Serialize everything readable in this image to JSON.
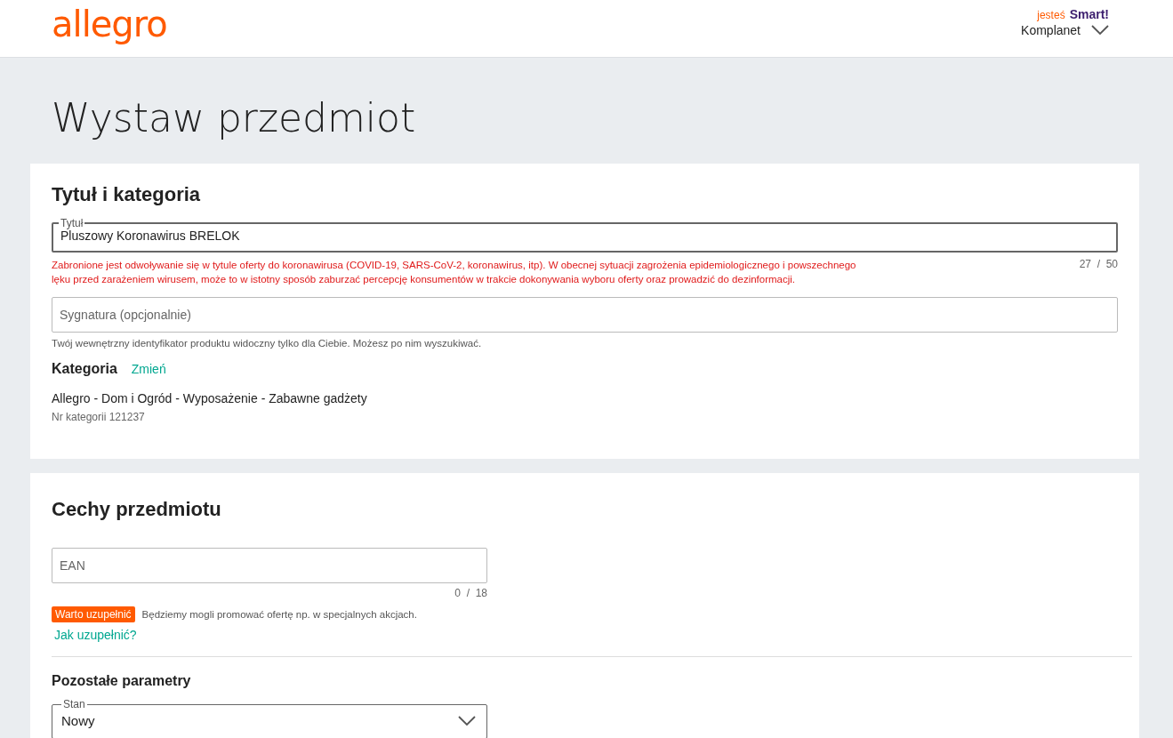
{
  "header": {
    "logo": "allegro",
    "smart_prefix": "jesteś",
    "smart_label": "Smart!",
    "user": "Komplanet"
  },
  "page_title": "Wystaw przedmiot",
  "title_section": {
    "heading": "Tytuł i kategoria",
    "title_field": {
      "label": "Tytuł",
      "value": "Pluszowy Koronawirus BRELOK",
      "error": "Zabronione jest odwoływanie się w tytule oferty do koronawirusa (COVID-19, SARS-CoV-2, koronawirus, itp). W obecnej sytuacji zagrożenia epidemiologicznego i powszechnego lęku przed zarażeniem wirusem, może to w istotny sposób zaburzać percepcję konsumentów w trakcie dokonywania wyboru oferty oraz prowadzić do dezinformacji.",
      "counter": "27  /  50"
    },
    "signature_field": {
      "placeholder": "Sygnatura (opcjonalnie)",
      "hint": "Twój wewnętrzny identyfikator produktu widoczny tylko dla Ciebie. Możesz po nim wyszukiwać."
    },
    "category": {
      "label": "Kategoria",
      "change_link": "Zmień",
      "path": "Allegro - Dom i Ogród - Wyposażenie - Zabawne gadżety",
      "number": "Nr kategorii 121237"
    }
  },
  "features_section": {
    "heading": "Cechy przedmiotu",
    "ean_field": {
      "placeholder": "EAN",
      "counter": "0  /  18",
      "badge": "Warto uzupełnić",
      "hint": "Będziemy mogli promować ofertę np. w specjalnych akcjach.",
      "help_link": "Jak uzupełnić?"
    },
    "other_heading": "Pozostałe parametry",
    "condition_field": {
      "label": "Stan",
      "value": "Nowy"
    }
  }
}
